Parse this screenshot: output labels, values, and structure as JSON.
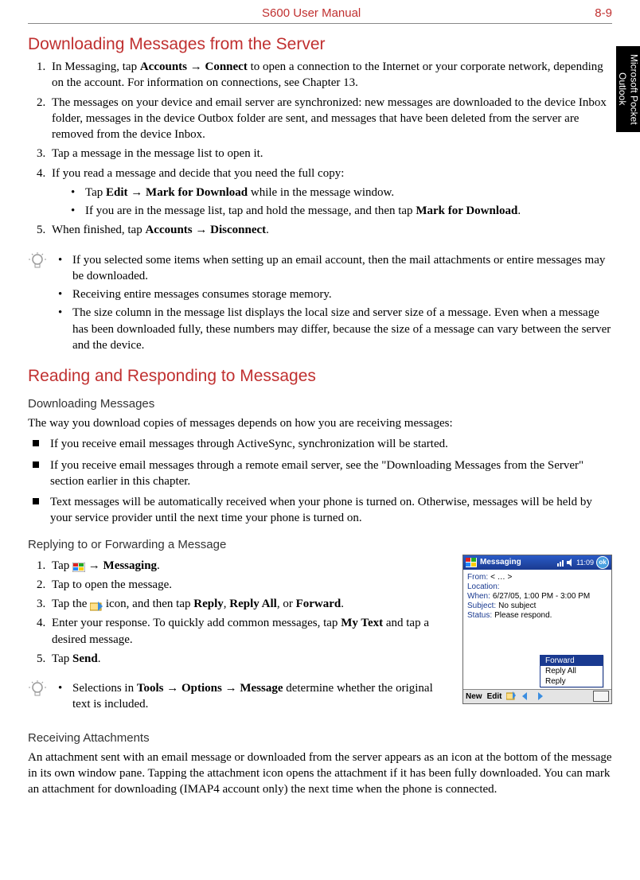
{
  "header": {
    "title": "S600 User Manual",
    "page": "8-9"
  },
  "side_tab": "Microsoft Pocket Outlook",
  "section1": {
    "title": "Downloading Messages from the Server",
    "ol": [
      {
        "pre": "In Messaging, tap ",
        "b1": "Accounts",
        "arr": " → ",
        "b2": "Connect",
        "post": " to open a connection to the Internet or your corporate network, depending on the account. For information on connections, see Chapter 13."
      },
      {
        "text": "The messages on your device and email server are synchronized: new messages are downloaded to the device Inbox folder, messages in the device Outbox folder are sent, and messages that have been deleted from the server are removed from the device Inbox."
      },
      {
        "text": "Tap a message in the message list to open it."
      },
      {
        "text": "If you read a message and decide that you need the full copy:",
        "sub": [
          {
            "pre": "Tap ",
            "b1": "Edit",
            "arr": " → ",
            "b2": "Mark for Download",
            "post": " while in the message window."
          },
          {
            "pre": "If you are in the message list, tap and hold the message, and then tap ",
            "b1": "Mark for Download",
            "post": "."
          }
        ]
      },
      {
        "pre": "When finished, tap ",
        "b1": "Accounts",
        "arr": " → ",
        "b2": "Disconnect",
        "post": "."
      }
    ],
    "note": [
      "If you selected some items when setting up an email account, then the mail attachments or entire messages may be downloaded.",
      "Receiving entire messages consumes storage memory.",
      "The size column in the message list displays the local size and server size of a message. Even when a message has been downloaded fully, these numbers may differ, because the size of a message can vary between the server and the device."
    ]
  },
  "section2": {
    "title": "Reading and Responding to Messages",
    "sub1": {
      "heading": "Downloading Messages",
      "intro": "The way you download copies of messages depends on how you are receiving messages:",
      "bullets": [
        "If you receive email messages through ActiveSync, synchronization will be started.",
        "If you receive email messages through a remote email server, see the \"Downloading Messages from the Server\" section earlier in this chapter.",
        "Text messages will be automatically received when your phone is turned on. Otherwise, messages will be held by your service provider until the next time your phone is turned on."
      ]
    },
    "sub2": {
      "heading": "Replying to or Forwarding a Message",
      "ol": [
        {
          "pre": "Tap ",
          "icon": "start",
          "arr": " → ",
          "b1": "Messaging",
          "post": "."
        },
        {
          "text": "Tap to open the message."
        },
        {
          "pre": "Tap the ",
          "icon": "folder",
          "mid": " icon, and then tap ",
          "b1": "Reply",
          "c1": ", ",
          "b2": "Reply All",
          "c2": ", or ",
          "b3": "Forward",
          "post": "."
        },
        {
          "pre": "Enter your response. To quickly add common messages, tap ",
          "b1": "My Text",
          "post": " and tap a desired message."
        },
        {
          "pre": "Tap ",
          "b1": "Send",
          "post": "."
        }
      ],
      "note": [
        {
          "pre": "Selections in ",
          "b1": "Tools",
          "arr1": " → ",
          "b2": "Options",
          "arr2": " → ",
          "b3": "Message",
          "post": " determine whether the original text is included."
        }
      ]
    },
    "sub3": {
      "heading": "Receiving Attachments",
      "para": "An attachment sent with an email message or downloaded from the server appears as an icon at the bottom of the message in its own window pane. Tapping the attachment icon opens the attachment if it has been fully downloaded. You can mark an attachment for downloading (IMAP4 account only) the next time when the phone is connected."
    }
  },
  "device": {
    "app": "Messaging",
    "time": "11:09",
    "ok": "ok",
    "rows": {
      "from_lbl": "From:",
      "from_val": "< … >",
      "loc_lbl": "Location:",
      "when_lbl": "When:",
      "when_val": "6/27/05, 1:00 PM - 3:00 PM",
      "subj_lbl": "Subject:",
      "subj_val": "No subject",
      "stat_lbl": "Status:",
      "stat_val": "Please respond."
    },
    "menu": {
      "forward": "Forward",
      "reply_all": "Reply All",
      "reply": "Reply"
    },
    "bottom": {
      "new": "New",
      "edit": "Edit"
    }
  }
}
